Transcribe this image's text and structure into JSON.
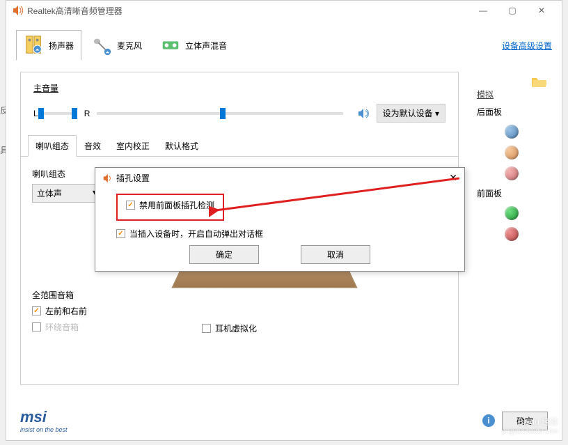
{
  "window": {
    "title": "Realtek高清晰音频管理器"
  },
  "deviceTabs": {
    "speakers": "扬声器",
    "mic": "麦克风",
    "stereoMix": "立体声混音"
  },
  "advLink": "设备高级设置",
  "volume": {
    "label": "主音量",
    "L": "L",
    "R": "R",
    "defaultBtn": "设为默认设备"
  },
  "subTabs": {
    "config": "喇叭组态",
    "fx": "音效",
    "room": "室内校正",
    "format": "默认格式"
  },
  "config": {
    "label": "喇叭组态",
    "option": "立体声"
  },
  "fullRange": {
    "label": "全范围音箱",
    "lr": "左前和右前",
    "surround": "环绕音箱"
  },
  "headphoneVirt": "耳机虚拟化",
  "sidePanel": {
    "sim": "模拟",
    "rear": "后面板",
    "front": "前面板"
  },
  "dialog": {
    "title": "插孔设置",
    "disableDetect": "禁用前面板插孔检测",
    "autoPopup": "当插入设备时，开启自动弹出对话框",
    "ok": "确定",
    "cancel": "取消"
  },
  "footer": {
    "brand": "msi",
    "tag": "insist on the best",
    "ok": "确定"
  },
  "sideLeft": {
    "a": "反",
    "b": "具"
  },
  "watermark": {
    "main": "Baidu 经验",
    "sub": "jingyan.baidu.com"
  }
}
